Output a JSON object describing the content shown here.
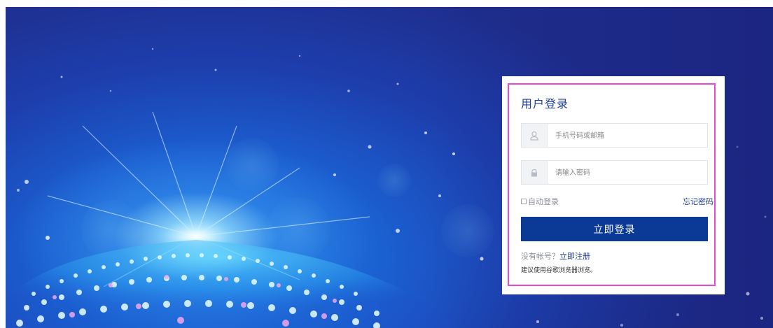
{
  "login": {
    "title": "用户登录",
    "account_placeholder": "手机号码或邮箱",
    "password_placeholder": "请输入密码",
    "remember_label": "自动登录",
    "forgot_label": "忘记密码",
    "submit_label": "立即登录",
    "no_account_text": "没有帐号？",
    "register_label": "立即注册",
    "browser_tip": "建议使用谷歌浏览器浏览。"
  },
  "colors": {
    "accent": "#0b3a96",
    "title": "#1f3f9a",
    "frame": "#e64ad6"
  }
}
